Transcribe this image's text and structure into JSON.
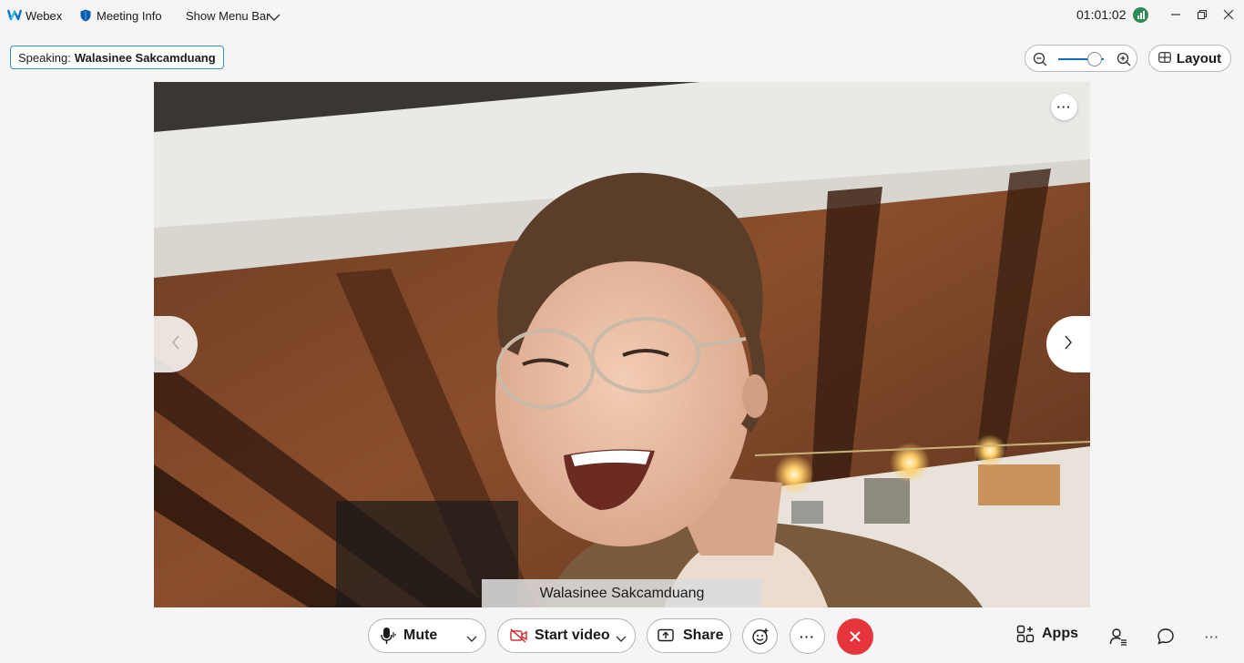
{
  "titlebar": {
    "app_name": "Webex",
    "meeting_info_label": "Meeting Info",
    "show_menu_bar_label": "Show Menu Bar",
    "timer": "01:01:02"
  },
  "speaking": {
    "prefix": "Speaking:",
    "name": "Walasinee Sakcamduang"
  },
  "view": {
    "layout_label": "Layout",
    "zoom_level": 0.8
  },
  "video": {
    "participant_name": "Walasinee Sakcamduang",
    "more_label": "···"
  },
  "controls": {
    "mute_label": "Mute",
    "start_video_label": "Start video",
    "share_label": "Share",
    "more_label": "···",
    "apps_label": "Apps",
    "overflow_label": "···"
  },
  "colors": {
    "accent": "#0a6fc2",
    "end_call": "#e5343c",
    "network_ok": "#2e8b57",
    "speaking_border": "#3b8cc4"
  },
  "icons": [
    "webex-logo-icon",
    "shield-icon",
    "chevron-down-icon",
    "network-icon",
    "minimize-icon",
    "restore-icon",
    "close-icon",
    "zoom-out-icon",
    "zoom-in-icon",
    "layout-icon",
    "microphone-icon",
    "video-off-icon",
    "share-screen-icon",
    "reactions-icon",
    "end-call-icon",
    "apps-icon",
    "participants-icon",
    "chat-icon"
  ]
}
